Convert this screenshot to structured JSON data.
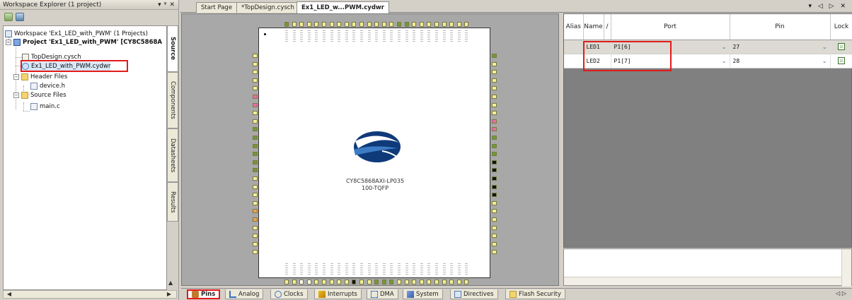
{
  "explorer": {
    "title": "Workspace Explorer (1 project)",
    "controls": [
      "▾",
      "ᵠ",
      "✕"
    ],
    "tree": {
      "workspace": "Workspace 'Ex1_LED_with_PWM' (1 Projects)",
      "project": "Project 'Ex1_LED_with_PWM' [CY8C5868A",
      "files": {
        "top_design": "TopDesign.cysch",
        "cydwr": "Ex1_LED_with_PWM.cydwr",
        "header_folder": "Header Files",
        "device_h": "device.h",
        "source_folder": "Source Files",
        "main_c": "main.c"
      }
    },
    "side_tabs": [
      "Source",
      "Components",
      "Datasheets",
      "Results"
    ]
  },
  "doc_tabs": {
    "tabs": [
      "Start Page",
      "*TopDesign.cysch",
      "Ex1_LED_w...PWM.cydwr"
    ],
    "active": 2,
    "controls": "▾ ◁ ▷ ✕"
  },
  "chip": {
    "part": "CY8C5868AXI-LP035",
    "package": "100-TQFP",
    "colors": {
      "yellow": "#f3ef9a",
      "green": "#6f9a35",
      "orange": "#f0a24a",
      "pink": "#f06aa8",
      "black": "#111111",
      "white": "#ffffff",
      "chip_blue": "#0f3a7a"
    }
  },
  "pin_table": {
    "columns": [
      "Alias",
      "Name",
      "/",
      "Port",
      "Pin",
      "Lock"
    ],
    "rows": [
      {
        "alias": "",
        "name": "LED1",
        "port": "P1[6]",
        "pin": "27",
        "lock": "☑"
      },
      {
        "alias": "",
        "name": "LED2",
        "port": "P1[7]",
        "pin": "28",
        "lock": "☑"
      }
    ],
    "dropdown_glyph": "⌄"
  },
  "bottom_tabs": {
    "tabs": [
      {
        "label": "Pins",
        "icon": "pin-icon"
      },
      {
        "label": "Analog",
        "icon": "analog-icon"
      },
      {
        "label": "Clocks",
        "icon": "clock-icon"
      },
      {
        "label": "Interrupts",
        "icon": "interrupt-icon"
      },
      {
        "label": "DMA",
        "icon": "dma-icon"
      },
      {
        "label": "System",
        "icon": "system-icon"
      },
      {
        "label": "Directives",
        "icon": "directives-icon"
      },
      {
        "label": "Flash Security",
        "icon": "flash-security-icon"
      }
    ],
    "active": 0,
    "nav": "◁ ▷"
  },
  "highlight_color": "#e21b1b"
}
